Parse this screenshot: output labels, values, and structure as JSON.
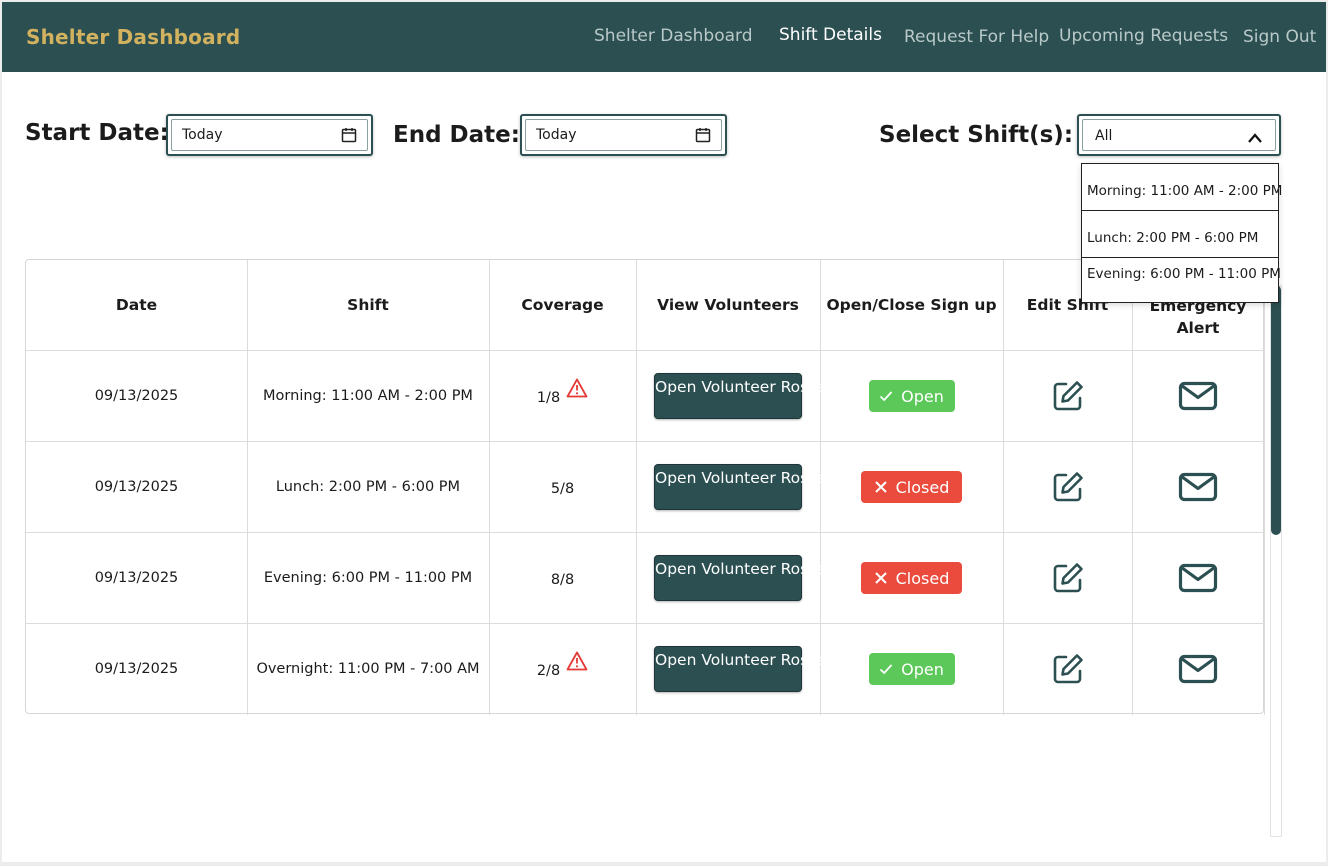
{
  "colors": {
    "primary": "#2c4f52",
    "brand_text": "#d2b25e",
    "open": "#5cc85a",
    "closed": "#ea4b3c",
    "warning": "#e53935"
  },
  "nav": {
    "brand": "Shelter Dashboard",
    "links": [
      "Shelter Dashboard",
      "Shift Details",
      "Request For Help",
      "Upcoming Requests",
      "Sign Out"
    ],
    "active": "Shift Details"
  },
  "filters": {
    "start_label": "Start Date:",
    "start_value": "Today",
    "end_label": "End Date:",
    "end_value": "Today",
    "shift_label": "Select Shift(s):",
    "shift_value": "All",
    "shift_options": [
      "Morning: 11:00 AM - 2:00 PM",
      "Lunch: 2:00 PM - 6:00 PM",
      "Evening: 6:00 PM - 11:00 PM"
    ]
  },
  "table": {
    "headers": [
      "Date",
      "Shift",
      "Coverage",
      "View Volunteers",
      "Open/Close Sign up",
      "Edit Shift",
      "Emergency Alert"
    ],
    "rows": [
      {
        "date": "09/13/2025",
        "shift": "Morning: 11:00 AM - 2:00 PM",
        "coverage": "1/8",
        "warning": true,
        "roster_label": "Open Volunteer Roster",
        "status": "Open",
        "status_icon": "check-icon"
      },
      {
        "date": "09/13/2025",
        "shift": "Lunch: 2:00 PM - 6:00 PM",
        "coverage": "5/8",
        "warning": false,
        "roster_label": "Open Volunteer Roster",
        "status": "Closed",
        "status_icon": "x-icon"
      },
      {
        "date": "09/13/2025",
        "shift": "Evening: 6:00 PM - 11:00 PM",
        "coverage": "8/8",
        "warning": false,
        "roster_label": "Open Volunteer Roster",
        "status": "Closed",
        "status_icon": "x-icon"
      },
      {
        "date": "09/13/2025",
        "shift": "Overnight: 11:00 PM - 7:00 AM",
        "coverage": "2/8",
        "warning": true,
        "roster_label": "Open Volunteer Roster",
        "status": "Open",
        "status_icon": "check-icon"
      }
    ]
  },
  "icons": {
    "date": "calendar-icon",
    "select": "chevron-up-icon",
    "warning": "warning-triangle-icon",
    "edit": "edit-icon",
    "alert": "mail-icon"
  }
}
